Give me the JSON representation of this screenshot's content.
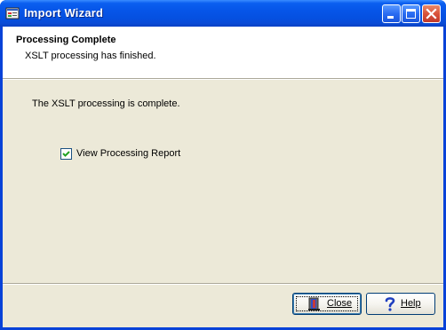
{
  "window": {
    "title": "Import Wizard",
    "icon": "import-wizard-icon",
    "title_buttons": [
      "minimize-icon",
      "maximize-icon",
      "close-icon"
    ],
    "colors": {
      "titlebar": "#0655e8",
      "client": "#ece9d8",
      "header_bg": "#ffffff"
    }
  },
  "header": {
    "title": "Processing Complete",
    "subtitle": "XSLT processing has finished."
  },
  "main": {
    "message": "The XSLT processing is complete.",
    "view_report": {
      "label": "View Processing Report",
      "checked": true
    }
  },
  "footer": {
    "close_label": "Close",
    "close_icon": "door-exit-icon",
    "help_label": "Help",
    "help_icon": "question-mark-icon"
  }
}
